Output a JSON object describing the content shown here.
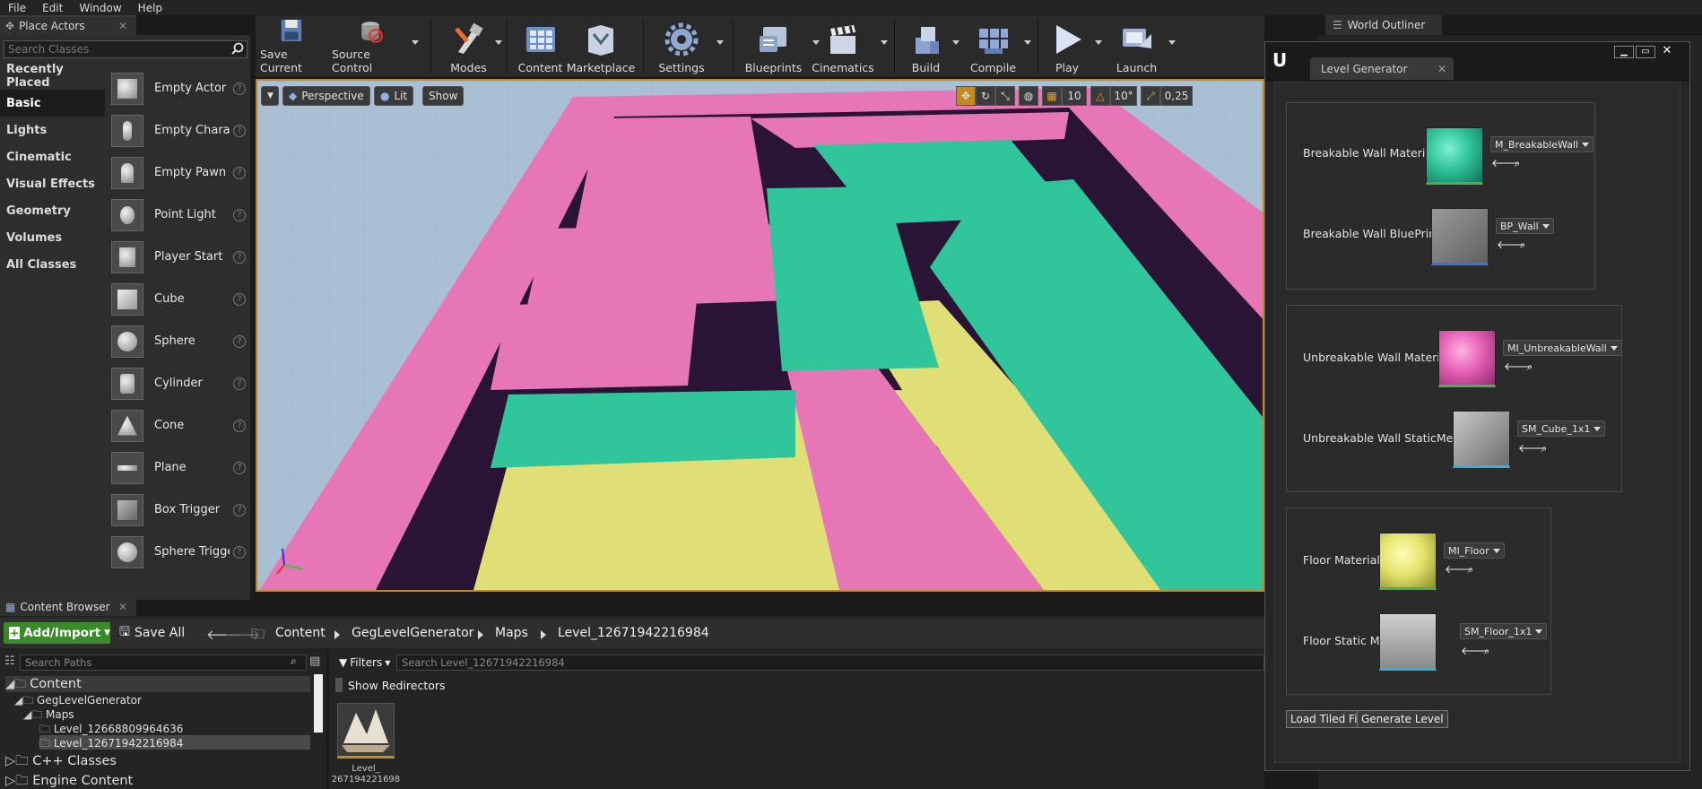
{
  "menu": [
    "File",
    "Edit",
    "Window",
    "Help"
  ],
  "place_actors": {
    "tab": "Place Actors",
    "search_placeholder": "Search Classes",
    "categories": [
      "Recently Placed",
      "Basic",
      "Lights",
      "Cinematic",
      "Visual Effects",
      "Geometry",
      "Volumes",
      "All Classes"
    ],
    "active_category": "Basic",
    "items": [
      "Empty Actor",
      "Empty Charact",
      "Empty Pawn",
      "Point Light",
      "Player Start",
      "Cube",
      "Sphere",
      "Cylinder",
      "Cone",
      "Plane",
      "Box Trigger",
      "Sphere Trigger"
    ]
  },
  "toolbar": {
    "save_current": "Save Current",
    "source_control": "Source Control",
    "modes": "Modes",
    "content": "Content",
    "marketplace": "Marketplace",
    "settings": "Settings",
    "blueprints": "Blueprints",
    "cinematics": "Cinematics",
    "build": "Build",
    "compile": "Compile",
    "play": "Play",
    "launch": "Launch"
  },
  "viewport": {
    "perspective": "Perspective",
    "lit": "Lit",
    "show": "Show",
    "grid_snap": "10",
    "rot_snap": "10°",
    "scale_snap": "0,25"
  },
  "world_outliner": {
    "tab": "World Outliner"
  },
  "level_generator": {
    "tab": "Level Generator",
    "rows": [
      {
        "label": "Breakable Wall Material",
        "value": "M_BreakableWall"
      },
      {
        "label": "Breakable Wall BluePrint",
        "value": "BP_Wall"
      },
      {
        "label": "Unbreakable Wall Material",
        "value": "MI_UnbreakableWall"
      },
      {
        "label": "Unbreakable Wall StaticMesh",
        "value": "SM_Cube_1x1"
      },
      {
        "label": "Floor Material",
        "value": "MI_Floor"
      },
      {
        "label": "Floor Static Mesh",
        "value": "SM_Floor_1x1"
      }
    ],
    "load_button": "Load Tiled File",
    "generate_button": "Generate Level",
    "colors": {
      "breakable": "#2fc39a",
      "unbreakable": "#e55fb5",
      "floor": "#e4e36a"
    }
  },
  "content_browser": {
    "tab": "Content Browser",
    "add_import": "Add/Import",
    "save_all": "Save All",
    "breadcrumbs": [
      "Content",
      "GegLevelGenerator",
      "Maps",
      "Level_12671942216984"
    ],
    "paths_placeholder": "Search Paths",
    "filters": "Filters",
    "asset_search_placeholder": "Search Level_12671942216984",
    "show_redirectors": "Show Redirectors",
    "tree": {
      "content": "Content",
      "geg": "GegLevelGenerator",
      "maps": "Maps",
      "level1": "Level_12668809964636",
      "level2": "Level_12671942216984",
      "cpp": "C++ Classes",
      "engine": "Engine Content"
    },
    "asset_name_line1": "Level_",
    "asset_name_line2": "267194221698"
  }
}
